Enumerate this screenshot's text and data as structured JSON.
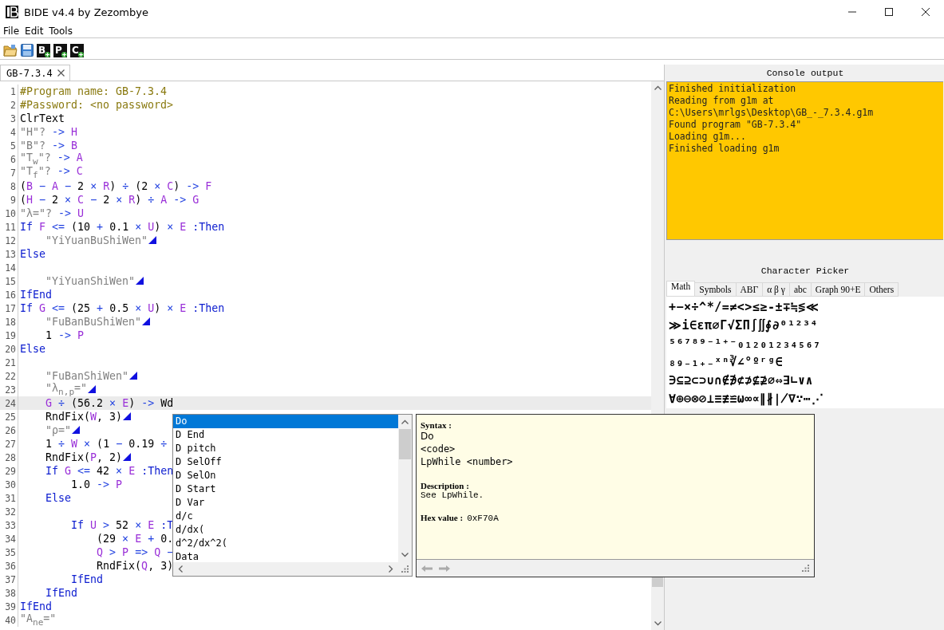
{
  "window": {
    "title": "BIDE v4.4 by Zezombye"
  },
  "menu": [
    "File",
    "Edit",
    "Tools"
  ],
  "toolbar": [
    {
      "kind": "open"
    },
    {
      "kind": "save"
    },
    {
      "kind": "new",
      "label": "B"
    },
    {
      "kind": "new",
      "label": "P"
    },
    {
      "kind": "new",
      "label": "C"
    }
  ],
  "tabs": [
    {
      "label": "GB-7.3.4",
      "selected": true
    }
  ],
  "editor": {
    "lines": [
      {
        "n": "1",
        "current": false,
        "display": false,
        "tokens": [
          {
            "kind": "pre",
            "text": "#Program name: GB-7.3.4"
          }
        ]
      },
      {
        "n": "2",
        "current": false,
        "display": false,
        "tokens": [
          {
            "kind": "pre",
            "text": "#Password: <no password>"
          }
        ]
      },
      {
        "n": "3",
        "current": false,
        "display": false,
        "tokens": [
          {
            "kind": "plain",
            "text": "ClrText"
          }
        ]
      },
      {
        "n": "4",
        "current": false,
        "display": false,
        "tokens": [
          {
            "kind": "str",
            "text": "\"H\"?"
          },
          {
            "kind": "op",
            "text": " -> "
          },
          {
            "kind": "var",
            "text": "H"
          }
        ]
      },
      {
        "n": "5",
        "current": false,
        "display": false,
        "tokens": [
          {
            "kind": "str",
            "text": "\"B\"?"
          },
          {
            "kind": "op",
            "text": " -> "
          },
          {
            "kind": "var",
            "text": "B"
          }
        ]
      },
      {
        "n": "6",
        "current": false,
        "display": false,
        "tokens": [
          {
            "kind": "str",
            "text": "\"T$_{w}$\"?"
          },
          {
            "kind": "op",
            "text": " -> "
          },
          {
            "kind": "var",
            "text": "A"
          }
        ]
      },
      {
        "n": "7",
        "current": false,
        "display": false,
        "tokens": [
          {
            "kind": "str",
            "text": "\"T$_{f}$\"?"
          },
          {
            "kind": "op",
            "text": " -> "
          },
          {
            "kind": "var",
            "text": "C"
          }
        ]
      },
      {
        "n": "8",
        "current": false,
        "display": false,
        "tokens": [
          {
            "kind": "plain",
            "text": "("
          },
          {
            "kind": "var",
            "text": "B"
          },
          {
            "kind": "op",
            "text": " − "
          },
          {
            "kind": "var",
            "text": "A"
          },
          {
            "kind": "op",
            "text": " − "
          },
          {
            "kind": "num",
            "text": "2"
          },
          {
            "kind": "op",
            "text": " × "
          },
          {
            "kind": "var",
            "text": "R"
          },
          {
            "kind": "plain",
            "text": ")"
          },
          {
            "kind": "op",
            "text": " ÷ "
          },
          {
            "kind": "plain",
            "text": "("
          },
          {
            "kind": "num",
            "text": "2"
          },
          {
            "kind": "op",
            "text": " × "
          },
          {
            "kind": "var",
            "text": "C"
          },
          {
            "kind": "plain",
            "text": ")"
          },
          {
            "kind": "op",
            "text": " -> "
          },
          {
            "kind": "var",
            "text": "F"
          }
        ]
      },
      {
        "n": "9",
        "current": false,
        "display": false,
        "tokens": [
          {
            "kind": "plain",
            "text": "("
          },
          {
            "kind": "var",
            "text": "H"
          },
          {
            "kind": "op",
            "text": " − "
          },
          {
            "kind": "num",
            "text": "2"
          },
          {
            "kind": "op",
            "text": " × "
          },
          {
            "kind": "var",
            "text": "C"
          },
          {
            "kind": "op",
            "text": " − "
          },
          {
            "kind": "num",
            "text": "2"
          },
          {
            "kind": "op",
            "text": " × "
          },
          {
            "kind": "var",
            "text": "R"
          },
          {
            "kind": "plain",
            "text": ")"
          },
          {
            "kind": "op",
            "text": " ÷ "
          },
          {
            "kind": "var",
            "text": "A"
          },
          {
            "kind": "op",
            "text": " -> "
          },
          {
            "kind": "var",
            "text": "G"
          }
        ]
      },
      {
        "n": "10",
        "current": false,
        "display": false,
        "tokens": [
          {
            "kind": "str",
            "text": "\"λ=\"?"
          },
          {
            "kind": "op",
            "text": " -> "
          },
          {
            "kind": "var",
            "text": "U"
          }
        ]
      },
      {
        "n": "11",
        "current": false,
        "display": false,
        "tokens": [
          {
            "kind": "kw",
            "text": "If "
          },
          {
            "kind": "var",
            "text": "F"
          },
          {
            "kind": "op",
            "text": " <= "
          },
          {
            "kind": "plain",
            "text": "("
          },
          {
            "kind": "num",
            "text": "10"
          },
          {
            "kind": "op",
            "text": " + "
          },
          {
            "kind": "num",
            "text": "0.1"
          },
          {
            "kind": "op",
            "text": " × "
          },
          {
            "kind": "var",
            "text": "U"
          },
          {
            "kind": "plain",
            "text": ")"
          },
          {
            "kind": "op",
            "text": " × "
          },
          {
            "kind": "var",
            "text": "E"
          },
          {
            "kind": "kw",
            "text": " :Then"
          }
        ]
      },
      {
        "n": "12",
        "current": false,
        "display": true,
        "tokens": [
          {
            "kind": "str",
            "text": "    \"YiYuanBuShiWen\""
          }
        ]
      },
      {
        "n": "13",
        "current": false,
        "display": false,
        "tokens": [
          {
            "kind": "kw",
            "text": "Else"
          }
        ]
      },
      {
        "n": "14",
        "current": false,
        "display": false
      },
      {
        "n": "15",
        "current": false,
        "display": true,
        "tokens": [
          {
            "kind": "str",
            "text": "    \"YiYuanShiWen\""
          }
        ]
      },
      {
        "n": "16",
        "current": false,
        "display": false,
        "tokens": [
          {
            "kind": "kw",
            "text": "IfEnd"
          }
        ]
      },
      {
        "n": "17",
        "current": false,
        "display": false,
        "tokens": [
          {
            "kind": "kw",
            "text": "If "
          },
          {
            "kind": "var",
            "text": "G"
          },
          {
            "kind": "op",
            "text": " <= "
          },
          {
            "kind": "plain",
            "text": "("
          },
          {
            "kind": "num",
            "text": "25"
          },
          {
            "kind": "op",
            "text": " + "
          },
          {
            "kind": "num",
            "text": "0.5"
          },
          {
            "kind": "op",
            "text": " × "
          },
          {
            "kind": "var",
            "text": "U"
          },
          {
            "kind": "plain",
            "text": ")"
          },
          {
            "kind": "op",
            "text": " × "
          },
          {
            "kind": "var",
            "text": "E"
          },
          {
            "kind": "kw",
            "text": " :Then"
          }
        ]
      },
      {
        "n": "18",
        "current": false,
        "display": true,
        "tokens": [
          {
            "kind": "str",
            "text": "    \"FuBanBuShiWen\""
          }
        ]
      },
      {
        "n": "19",
        "current": false,
        "display": false,
        "tokens": [
          {
            "kind": "num",
            "text": "    1"
          },
          {
            "kind": "op",
            "text": " -> "
          },
          {
            "kind": "var",
            "text": "P"
          }
        ]
      },
      {
        "n": "20",
        "current": false,
        "display": false,
        "tokens": [
          {
            "kind": "kw",
            "text": "Else"
          }
        ]
      },
      {
        "n": "21",
        "current": false,
        "display": false
      },
      {
        "n": "22",
        "current": false,
        "display": true,
        "tokens": [
          {
            "kind": "str",
            "text": "    \"FuBanShiWen\""
          }
        ]
      },
      {
        "n": "23",
        "current": false,
        "display": true,
        "tokens": [
          {
            "kind": "str",
            "text": "    \"λ$_{n,p}$=\""
          }
        ]
      },
      {
        "n": "24",
        "current": true,
        "display": false,
        "tokens": [
          {
            "kind": "var",
            "text": "    G"
          },
          {
            "kind": "op",
            "text": " ÷ "
          },
          {
            "kind": "plain",
            "text": "("
          },
          {
            "kind": "num",
            "text": "56.2"
          },
          {
            "kind": "op",
            "text": " × "
          },
          {
            "kind": "var",
            "text": "E"
          },
          {
            "kind": "plain",
            "text": ")"
          },
          {
            "kind": "op",
            "text": " -> "
          },
          {
            "kind": "plain",
            "text": "Wd"
          }
        ]
      },
      {
        "n": "25",
        "current": false,
        "display": true,
        "tokens": [
          {
            "kind": "plain",
            "text": "    RndFix("
          },
          {
            "kind": "var",
            "text": "W"
          },
          {
            "kind": "plain",
            "text": ", 3)"
          }
        ]
      },
      {
        "n": "26",
        "current": false,
        "display": true,
        "tokens": [
          {
            "kind": "str",
            "text": "    \"ρ=\""
          }
        ]
      },
      {
        "n": "27",
        "current": false,
        "display": false,
        "tokens": [
          {
            "kind": "num",
            "text": "    1"
          },
          {
            "kind": "op",
            "text": " ÷ "
          },
          {
            "kind": "var",
            "text": "W"
          },
          {
            "kind": "op",
            "text": " × "
          },
          {
            "kind": "plain",
            "text": "("
          },
          {
            "kind": "num",
            "text": "1"
          },
          {
            "kind": "op",
            "text": " − "
          },
          {
            "kind": "num",
            "text": "0.19"
          },
          {
            "kind": "op",
            "text": " ÷"
          }
        ]
      },
      {
        "n": "28",
        "current": false,
        "display": true,
        "tokens": [
          {
            "kind": "plain",
            "text": "    RndFix("
          },
          {
            "kind": "var",
            "text": "P"
          },
          {
            "kind": "plain",
            "text": ", 2)"
          }
        ]
      },
      {
        "n": "29",
        "current": false,
        "display": false,
        "tokens": [
          {
            "kind": "kw",
            "text": "    If "
          },
          {
            "kind": "var",
            "text": "G"
          },
          {
            "kind": "op",
            "text": " <= "
          },
          {
            "kind": "num",
            "text": "42"
          },
          {
            "kind": "op",
            "text": " × "
          },
          {
            "kind": "var",
            "text": "E"
          },
          {
            "kind": "kw",
            "text": " :Then"
          }
        ]
      },
      {
        "n": "30",
        "current": false,
        "display": false,
        "tokens": [
          {
            "kind": "num",
            "text": "        1.0"
          },
          {
            "kind": "op",
            "text": " -> "
          },
          {
            "kind": "var",
            "text": "P"
          }
        ]
      },
      {
        "n": "31",
        "current": false,
        "display": false,
        "tokens": [
          {
            "kind": "kw",
            "text": "    Else"
          }
        ]
      },
      {
        "n": "32",
        "current": false,
        "display": false
      },
      {
        "n": "33",
        "current": false,
        "display": false,
        "tokens": [
          {
            "kind": "kw",
            "text": "        If "
          },
          {
            "kind": "var",
            "text": "U"
          },
          {
            "kind": "op",
            "text": " > "
          },
          {
            "kind": "num",
            "text": "52"
          },
          {
            "kind": "op",
            "text": " × "
          },
          {
            "kind": "var",
            "text": "E"
          },
          {
            "kind": "kw",
            "text": " :T"
          }
        ]
      },
      {
        "n": "34",
        "current": false,
        "display": false,
        "tokens": [
          {
            "kind": "plain",
            "text": "            ("
          },
          {
            "kind": "num",
            "text": "29"
          },
          {
            "kind": "op",
            "text": " × "
          },
          {
            "kind": "var",
            "text": "E"
          },
          {
            "kind": "op",
            "text": " + "
          },
          {
            "kind": "num",
            "text": "0."
          }
        ]
      },
      {
        "n": "35",
        "current": false,
        "display": false,
        "tokens": [
          {
            "kind": "var",
            "text": "            Q"
          },
          {
            "kind": "op",
            "text": " > "
          },
          {
            "kind": "var",
            "text": "P"
          },
          {
            "kind": "op",
            "text": " => "
          },
          {
            "kind": "var",
            "text": "Q"
          },
          {
            "kind": "op",
            "text": " −"
          }
        ]
      },
      {
        "n": "36",
        "current": false,
        "display": false,
        "tokens": [
          {
            "kind": "plain",
            "text": "            RndFix("
          },
          {
            "kind": "var",
            "text": "Q"
          },
          {
            "kind": "plain",
            "text": ", 3)"
          }
        ]
      },
      {
        "n": "37",
        "current": false,
        "display": false,
        "tokens": [
          {
            "kind": "kw",
            "text": "        IfEnd"
          }
        ]
      },
      {
        "n": "38",
        "current": false,
        "display": false,
        "tokens": [
          {
            "kind": "kw",
            "text": "    IfEnd"
          }
        ]
      },
      {
        "n": "39",
        "current": false,
        "display": false,
        "tokens": [
          {
            "kind": "kw",
            "text": "IfEnd"
          }
        ]
      },
      {
        "n": "40",
        "current": false,
        "display": false,
        "tokens": [
          {
            "kind": "str",
            "text": "\"A$_{ne}$=\""
          }
        ]
      }
    ]
  },
  "autocomplete": {
    "items": [
      {
        "label": "Do",
        "selected": true
      },
      {
        "label": "D End",
        "selected": false
      },
      {
        "label": "D pitch",
        "selected": false
      },
      {
        "label": "D SelOff",
        "selected": false
      },
      {
        "label": "D SelOn",
        "selected": false
      },
      {
        "label": "D Start",
        "selected": false
      },
      {
        "label": "D Var",
        "selected": false
      },
      {
        "label": "d/c",
        "selected": false
      },
      {
        "label": "d/dx(",
        "selected": false
      },
      {
        "label": "d^2/dx^2(",
        "selected": false
      },
      {
        "label": "Data",
        "selected": false
      }
    ]
  },
  "doc_tooltip": {
    "syntax_heading": "Syntax :",
    "syntax": [
      "Do",
      "<code>",
      "LpWhile <number>"
    ],
    "description_heading": "Description :",
    "description": "See LpWhile.",
    "hex_heading": "Hex value :",
    "hex": "0xF70A"
  },
  "console": {
    "title": "Console output",
    "lines": [
      "Finished initialization",
      "Reading from g1m at",
      "C:\\Users\\mrlgs\\Desktop\\GB_-_7.3.4.g1m",
      "Found program \"GB-7.3.4\"",
      "Loading g1m...",
      "Finished loading g1m"
    ]
  },
  "character_picker": {
    "title": "Character Picker",
    "tabs": [
      {
        "label": "Math",
        "selected": true
      },
      {
        "label": "Symbols",
        "selected": false
      },
      {
        "label": "ABΓ",
        "selected": false
      },
      {
        "label": "α β γ",
        "selected": false
      },
      {
        "label": "abc",
        "selected": false
      },
      {
        "label": "Graph 90+E",
        "selected": false
      },
      {
        "label": "Others",
        "selected": false
      }
    ],
    "rows": [
      "+−×÷^*/=≠<>≤≥-±∓≒≶≪",
      "≫i∈επ∅Γ√ΣΠ∫∬∮∂⁰¹²³⁴",
      "⁵⁶⁷⁸⁹⁻¹⁺⁻₀₁₂₀₁₂₃₄₅₆₇",
      "₈₉₋₁₊₋ˣⁿ∛∠°ºʳᵍ∈",
      "∋⊆⊇⊂⊃∪∩∉∌⊄⊅⊈⊉∅⇔∃∟∨∧",
      "∀⊕⊖⊗⊘⊥≡≢≌ω∞∝∥∦∤∇∵⋯⋰"
    ]
  }
}
